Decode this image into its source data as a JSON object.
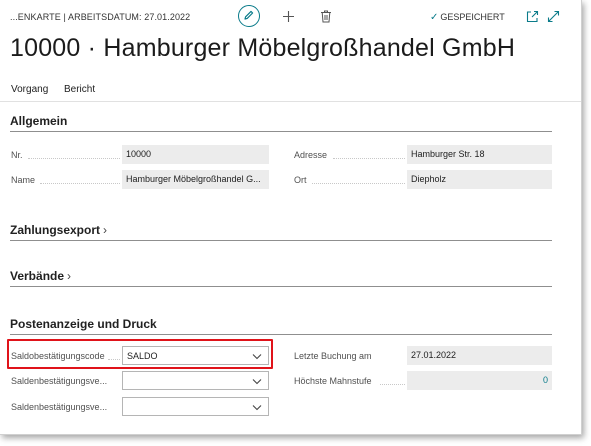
{
  "header": {
    "breadcrumb": "...ENKARTE | ARBEITSDATUM: 27.01.2022",
    "saved_status": "GESPEICHERT",
    "title": "10000 · Hamburger Möbelgroßhandel GmbH"
  },
  "toolbar_icons": [
    "edit-icon",
    "plus-icon",
    "trash-icon",
    "checkmark-icon",
    "open-new-window-icon",
    "expand-icon"
  ],
  "actions": {
    "vorgang": "Vorgang",
    "bericht": "Bericht"
  },
  "sections": {
    "allgemein": "Allgemein",
    "zahlungsexport": "Zahlungsexport",
    "verbaende": "Verbände",
    "postenanzeige": "Postenanzeige und Druck"
  },
  "allgemein": {
    "nr_label": "Nr.",
    "nr_value": "10000",
    "name_label": "Name",
    "name_value": "Hamburger Möbelgroßhandel G...",
    "adresse_label": "Adresse",
    "adresse_value": "Hamburger Str. 18",
    "ort_label": "Ort",
    "ort_value": "Diepholz"
  },
  "postenanzeige": {
    "saldo_code_label": "Saldobestätigungscode",
    "saldo_code_value": "SALDO",
    "salden_ve1_label": "Saldenbestätigungsve...",
    "salden_ve1_value": "",
    "salden_ve2_label": "Saldenbestätigungsve...",
    "salden_ve2_value": "",
    "letzte_buchung_label": "Letzte Buchung am",
    "letzte_buchung_value": "27.01.2022",
    "hoechste_mahnstufe_label": "Höchste Mahnstufe",
    "hoechste_mahnstufe_value": "0"
  },
  "colors": {
    "accent": "#0a7b8a",
    "highlight": "#e0131a",
    "field_bg": "#ececec"
  }
}
